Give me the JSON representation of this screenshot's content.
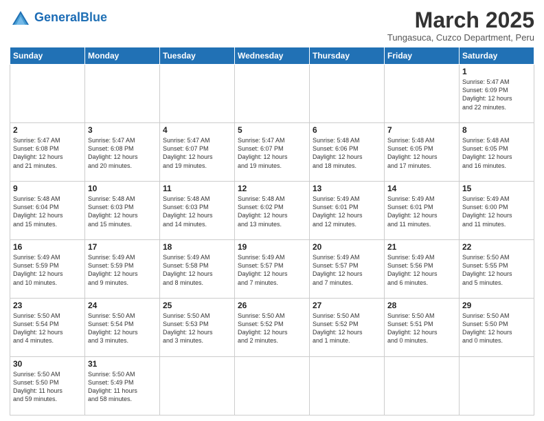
{
  "logo": {
    "text_general": "General",
    "text_blue": "Blue"
  },
  "title": "March 2025",
  "subtitle": "Tungasuca, Cuzco Department, Peru",
  "weekdays": [
    "Sunday",
    "Monday",
    "Tuesday",
    "Wednesday",
    "Thursday",
    "Friday",
    "Saturday"
  ],
  "weeks": [
    [
      {
        "day": "",
        "info": ""
      },
      {
        "day": "",
        "info": ""
      },
      {
        "day": "",
        "info": ""
      },
      {
        "day": "",
        "info": ""
      },
      {
        "day": "",
        "info": ""
      },
      {
        "day": "",
        "info": ""
      },
      {
        "day": "1",
        "info": "Sunrise: 5:47 AM\nSunset: 6:09 PM\nDaylight: 12 hours\nand 22 minutes."
      }
    ],
    [
      {
        "day": "2",
        "info": "Sunrise: 5:47 AM\nSunset: 6:08 PM\nDaylight: 12 hours\nand 21 minutes."
      },
      {
        "day": "3",
        "info": "Sunrise: 5:47 AM\nSunset: 6:08 PM\nDaylight: 12 hours\nand 20 minutes."
      },
      {
        "day": "4",
        "info": "Sunrise: 5:47 AM\nSunset: 6:07 PM\nDaylight: 12 hours\nand 19 minutes."
      },
      {
        "day": "5",
        "info": "Sunrise: 5:47 AM\nSunset: 6:07 PM\nDaylight: 12 hours\nand 19 minutes."
      },
      {
        "day": "6",
        "info": "Sunrise: 5:48 AM\nSunset: 6:06 PM\nDaylight: 12 hours\nand 18 minutes."
      },
      {
        "day": "7",
        "info": "Sunrise: 5:48 AM\nSunset: 6:05 PM\nDaylight: 12 hours\nand 17 minutes."
      },
      {
        "day": "8",
        "info": "Sunrise: 5:48 AM\nSunset: 6:05 PM\nDaylight: 12 hours\nand 16 minutes."
      }
    ],
    [
      {
        "day": "9",
        "info": "Sunrise: 5:48 AM\nSunset: 6:04 PM\nDaylight: 12 hours\nand 15 minutes."
      },
      {
        "day": "10",
        "info": "Sunrise: 5:48 AM\nSunset: 6:03 PM\nDaylight: 12 hours\nand 15 minutes."
      },
      {
        "day": "11",
        "info": "Sunrise: 5:48 AM\nSunset: 6:03 PM\nDaylight: 12 hours\nand 14 minutes."
      },
      {
        "day": "12",
        "info": "Sunrise: 5:48 AM\nSunset: 6:02 PM\nDaylight: 12 hours\nand 13 minutes."
      },
      {
        "day": "13",
        "info": "Sunrise: 5:49 AM\nSunset: 6:01 PM\nDaylight: 12 hours\nand 12 minutes."
      },
      {
        "day": "14",
        "info": "Sunrise: 5:49 AM\nSunset: 6:01 PM\nDaylight: 12 hours\nand 11 minutes."
      },
      {
        "day": "15",
        "info": "Sunrise: 5:49 AM\nSunset: 6:00 PM\nDaylight: 12 hours\nand 11 minutes."
      }
    ],
    [
      {
        "day": "16",
        "info": "Sunrise: 5:49 AM\nSunset: 5:59 PM\nDaylight: 12 hours\nand 10 minutes."
      },
      {
        "day": "17",
        "info": "Sunrise: 5:49 AM\nSunset: 5:59 PM\nDaylight: 12 hours\nand 9 minutes."
      },
      {
        "day": "18",
        "info": "Sunrise: 5:49 AM\nSunset: 5:58 PM\nDaylight: 12 hours\nand 8 minutes."
      },
      {
        "day": "19",
        "info": "Sunrise: 5:49 AM\nSunset: 5:57 PM\nDaylight: 12 hours\nand 7 minutes."
      },
      {
        "day": "20",
        "info": "Sunrise: 5:49 AM\nSunset: 5:57 PM\nDaylight: 12 hours\nand 7 minutes."
      },
      {
        "day": "21",
        "info": "Sunrise: 5:49 AM\nSunset: 5:56 PM\nDaylight: 12 hours\nand 6 minutes."
      },
      {
        "day": "22",
        "info": "Sunrise: 5:50 AM\nSunset: 5:55 PM\nDaylight: 12 hours\nand 5 minutes."
      }
    ],
    [
      {
        "day": "23",
        "info": "Sunrise: 5:50 AM\nSunset: 5:54 PM\nDaylight: 12 hours\nand 4 minutes."
      },
      {
        "day": "24",
        "info": "Sunrise: 5:50 AM\nSunset: 5:54 PM\nDaylight: 12 hours\nand 3 minutes."
      },
      {
        "day": "25",
        "info": "Sunrise: 5:50 AM\nSunset: 5:53 PM\nDaylight: 12 hours\nand 3 minutes."
      },
      {
        "day": "26",
        "info": "Sunrise: 5:50 AM\nSunset: 5:52 PM\nDaylight: 12 hours\nand 2 minutes."
      },
      {
        "day": "27",
        "info": "Sunrise: 5:50 AM\nSunset: 5:52 PM\nDaylight: 12 hours\nand 1 minute."
      },
      {
        "day": "28",
        "info": "Sunrise: 5:50 AM\nSunset: 5:51 PM\nDaylight: 12 hours\nand 0 minutes."
      },
      {
        "day": "29",
        "info": "Sunrise: 5:50 AM\nSunset: 5:50 PM\nDaylight: 12 hours\nand 0 minutes."
      }
    ],
    [
      {
        "day": "30",
        "info": "Sunrise: 5:50 AM\nSunset: 5:50 PM\nDaylight: 11 hours\nand 59 minutes."
      },
      {
        "day": "31",
        "info": "Sunrise: 5:50 AM\nSunset: 5:49 PM\nDaylight: 11 hours\nand 58 minutes."
      },
      {
        "day": "",
        "info": ""
      },
      {
        "day": "",
        "info": ""
      },
      {
        "day": "",
        "info": ""
      },
      {
        "day": "",
        "info": ""
      },
      {
        "day": "",
        "info": ""
      }
    ]
  ]
}
